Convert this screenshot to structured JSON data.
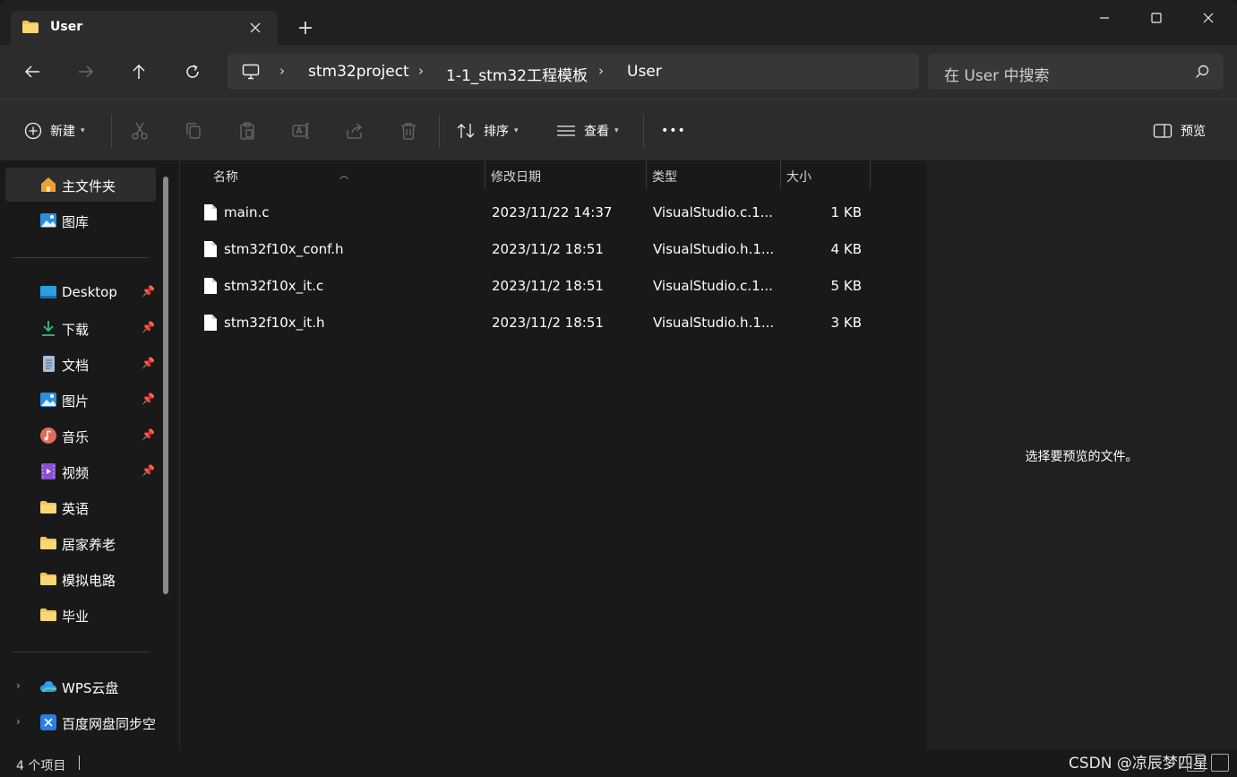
{
  "tab": {
    "title": "User",
    "folder_icon": "folder-icon",
    "close_icon": "close-icon"
  },
  "new_tab_label": "+",
  "window_controls": {
    "minimize": "minimize-icon",
    "maximize": "maximize-icon",
    "close": "close-icon"
  },
  "nav": {
    "back": "back-arrow-icon",
    "forward": "forward-arrow-icon",
    "up": "up-arrow-icon",
    "refresh": "refresh-icon"
  },
  "breadcrumb": [
    "stm32project",
    "1-1_stm32工程模板",
    "User"
  ],
  "search": {
    "placeholder": "在 User 中搜索"
  },
  "commands": {
    "new": "新建",
    "sort": "排序",
    "view": "查看",
    "more": "•••",
    "preview": "预览",
    "icons": [
      "cut-icon",
      "copy-icon",
      "paste-icon",
      "rename-icon",
      "share-icon",
      "delete-icon"
    ]
  },
  "sidebar": {
    "quick": [
      {
        "label": "主文件夹",
        "icon": "home-icon"
      },
      {
        "label": "图库",
        "icon": "gallery-icon"
      }
    ],
    "pinned": [
      {
        "label": "Desktop",
        "icon": "desktop-icon",
        "pinned": true
      },
      {
        "label": "下载",
        "icon": "download-icon",
        "pinned": true
      },
      {
        "label": "文档",
        "icon": "document-icon",
        "pinned": true
      },
      {
        "label": "图片",
        "icon": "pictures-icon",
        "pinned": true
      },
      {
        "label": "音乐",
        "icon": "music-icon",
        "pinned": true
      },
      {
        "label": "视频",
        "icon": "video-icon",
        "pinned": true
      },
      {
        "label": "英语",
        "icon": "folder-icon",
        "pinned": false
      },
      {
        "label": "居家养老",
        "icon": "folder-icon",
        "pinned": false
      },
      {
        "label": "模拟电路",
        "icon": "folder-icon",
        "pinned": false
      },
      {
        "label": "毕业",
        "icon": "folder-icon",
        "pinned": false
      }
    ],
    "drives": [
      {
        "label": "WPS云盘",
        "icon": "cloud-icon"
      },
      {
        "label": "百度网盘同步空",
        "icon": "baidu-netdisk-icon"
      }
    ]
  },
  "columns": {
    "name": "名称",
    "modified": "修改日期",
    "type": "类型",
    "size": "大小"
  },
  "files": [
    {
      "name": "main.c",
      "modified": "2023/11/22 14:37",
      "type": "VisualStudio.c.1...",
      "size": "1 KB"
    },
    {
      "name": "stm32f10x_conf.h",
      "modified": "2023/11/2 18:51",
      "type": "VisualStudio.h.1...",
      "size": "4 KB"
    },
    {
      "name": "stm32f10x_it.c",
      "modified": "2023/11/2 18:51",
      "type": "VisualStudio.c.1...",
      "size": "5 KB"
    },
    {
      "name": "stm32f10x_it.h",
      "modified": "2023/11/2 18:51",
      "type": "VisualStudio.h.1...",
      "size": "3 KB"
    }
  ],
  "preview_message": "选择要预览的文件。",
  "status": {
    "count": "4 个项目",
    "watermark": "CSDN @凉辰梦四星"
  },
  "colors": {
    "background": "#191919",
    "chrome": "#2c2c2c",
    "folder": "#f3c553",
    "accent": "#4cc2ff"
  }
}
